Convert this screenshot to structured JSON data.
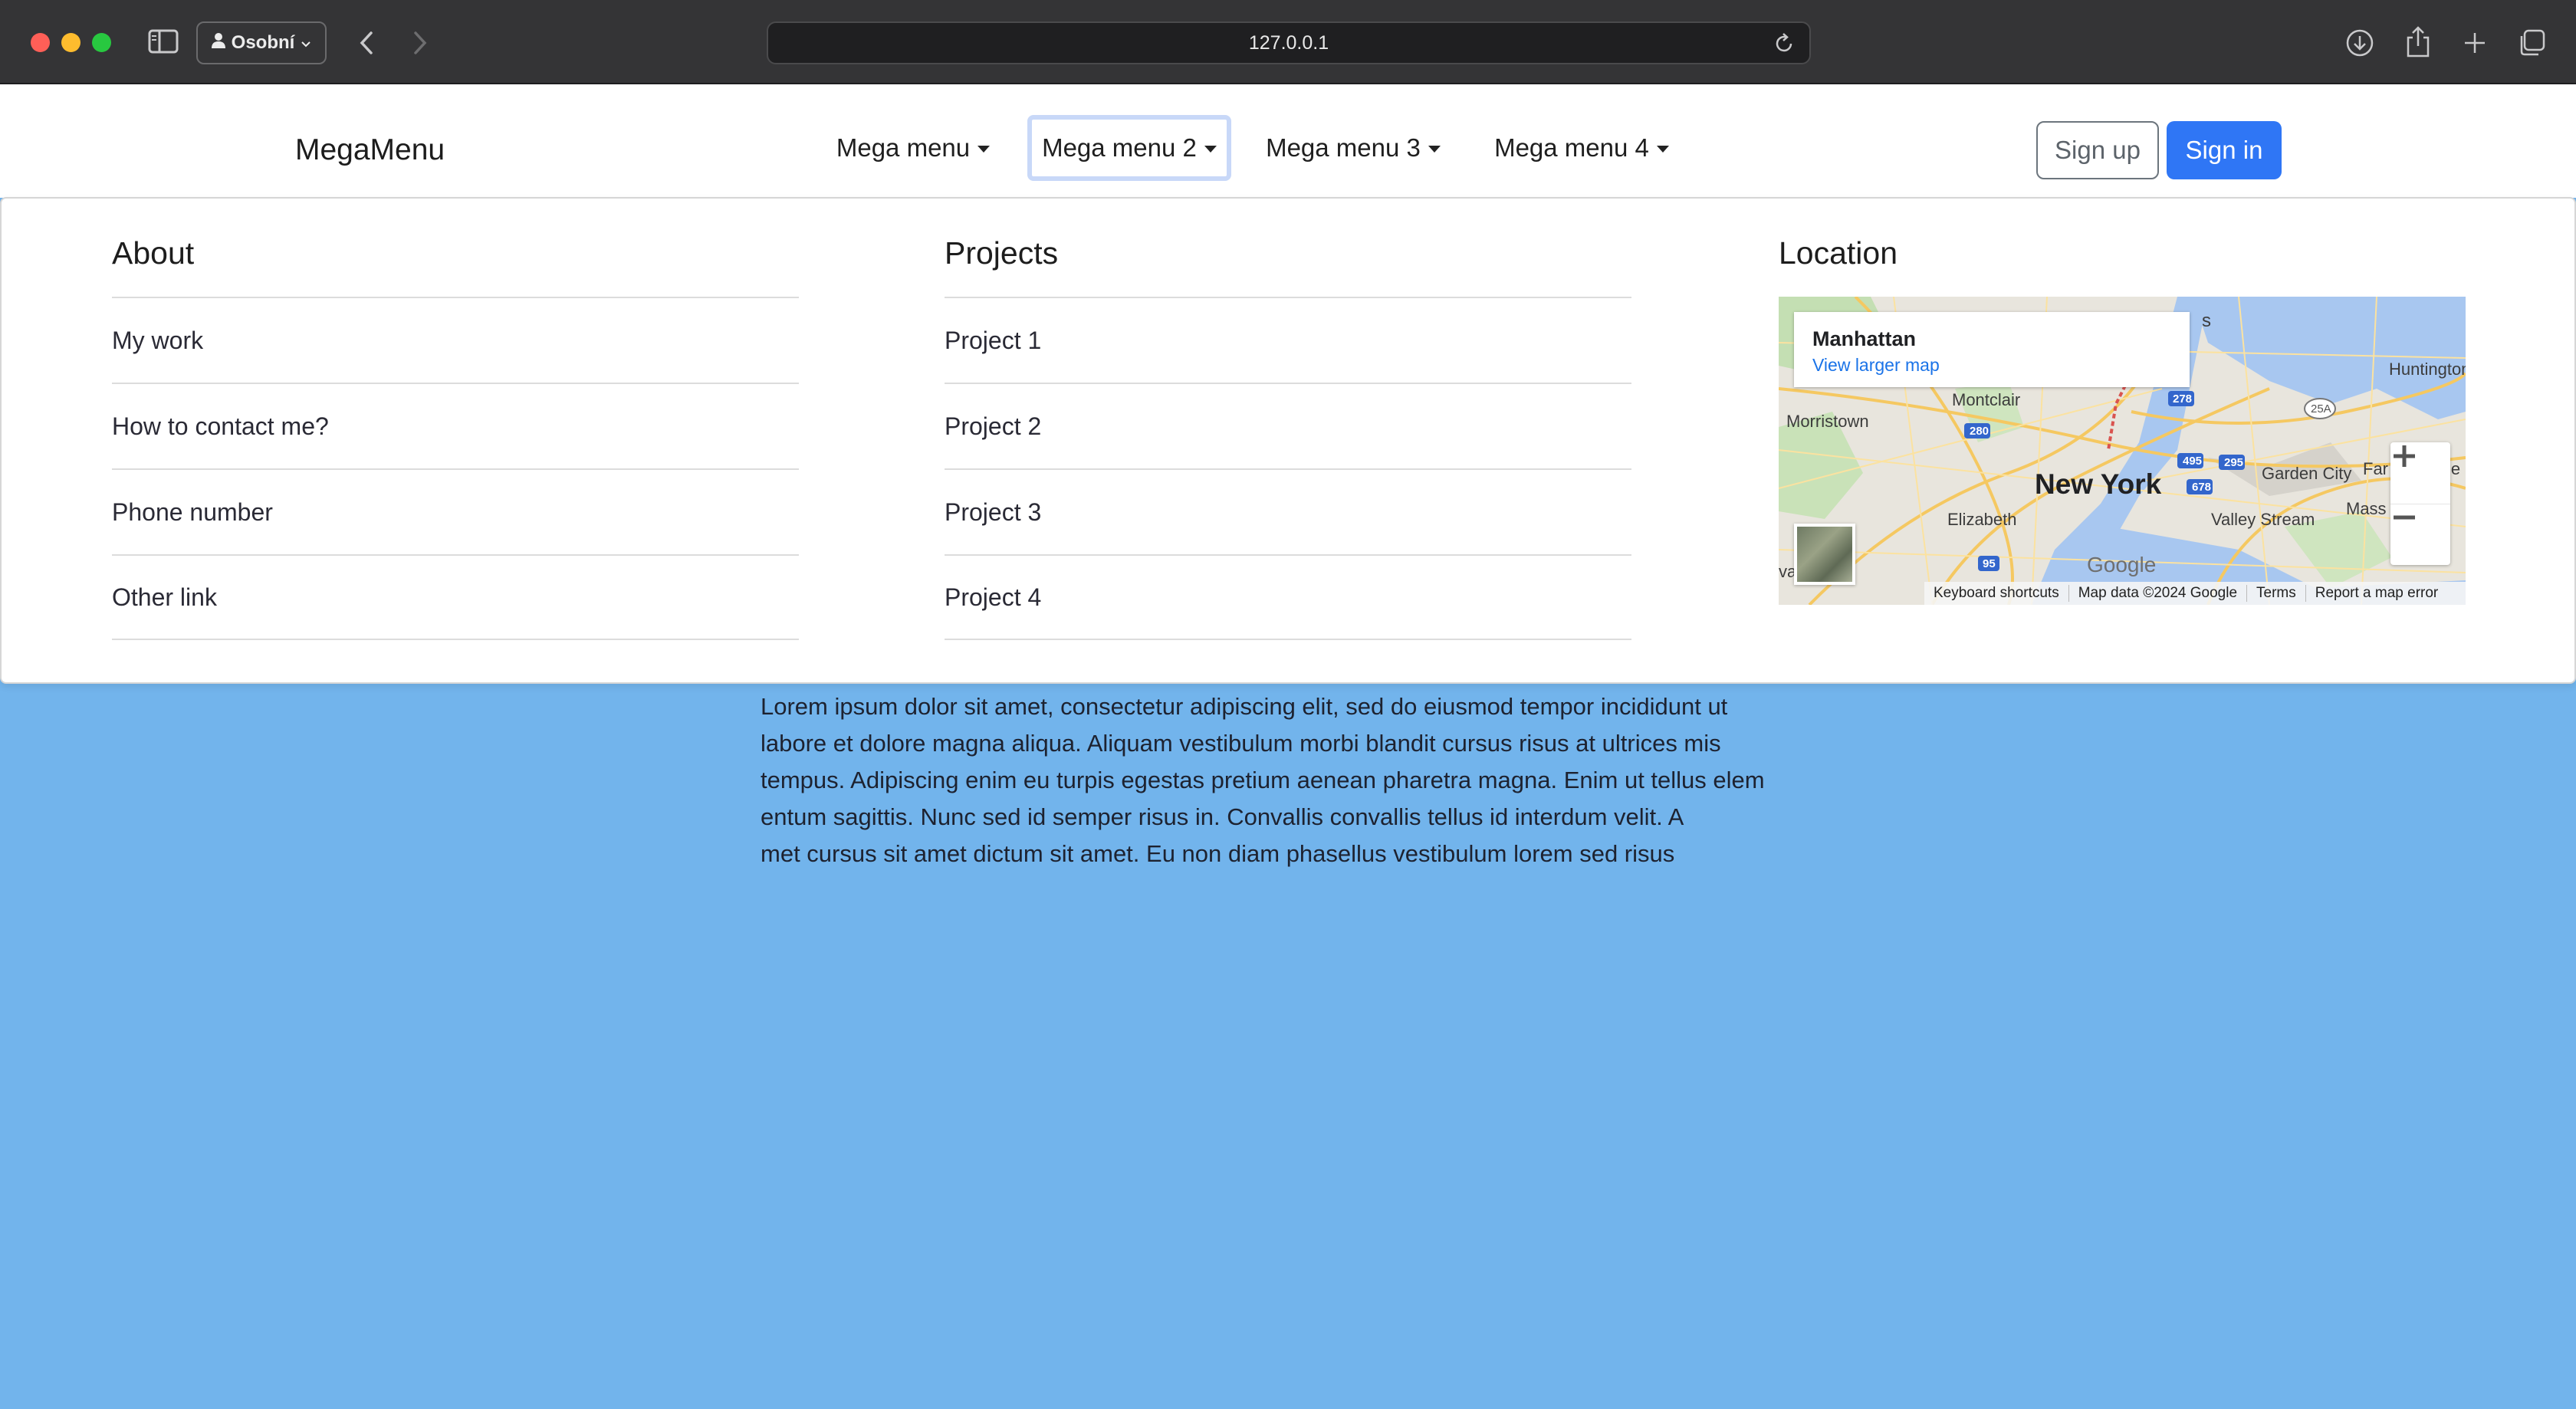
{
  "browser": {
    "profile_label": "Osobní",
    "url": "127.0.0.1"
  },
  "navbar": {
    "brand": "MegaMenu",
    "menus": [
      "Mega menu",
      "Mega menu 2",
      "Mega menu 3",
      "Mega menu 4"
    ],
    "sign_up": "Sign up",
    "sign_in": "Sign in"
  },
  "mega": {
    "about": {
      "title": "About",
      "links": [
        "My work",
        "How to contact me?",
        "Phone number",
        "Other link"
      ]
    },
    "projects": {
      "title": "Projects",
      "links": [
        "Project 1",
        "Project 2",
        "Project 3",
        "Project 4"
      ]
    },
    "location": {
      "title": "Location",
      "place": "Manhattan",
      "larger_map": "View larger map",
      "labels": {
        "montclair": "Montclair",
        "morristown": "Morristown",
        "new_york": "New York",
        "elizabeth": "Elizabeth",
        "garden_city": "Garden City",
        "valley_stream": "Valley Stream",
        "huntington": "Huntington",
        "far": "Far",
        "mass": "Mass",
        "s": "s",
        "le": "le",
        "va": "va"
      },
      "google": "Google",
      "footer": [
        "Keyboard shortcuts",
        "Map data ©2024 Google",
        "Terms",
        "Report a map error"
      ]
    }
  },
  "lorem_lines": [
    "Lorem ipsum dolor sit amet, consectetur adipiscing elit, sed do eiusmod tempor incididunt ut",
    "labore et dolore magna aliqua. Aliquam vestibulum morbi blandit cursus risus at ultrices mis",
    "tempus. Adipiscing enim eu turpis egestas pretium aenean pharetra magna. Enim ut tellus elem",
    "entum sagittis. Nunc sed id semper risus in. Convallis convallis tellus id interdum velit. A",
    "met cursus sit amet dictum sit amet. Eu non diam phasellus vestibulum lorem sed risus"
  ],
  "colors": {
    "page_background": "#72b4ec",
    "primary": "#2f76f5",
    "link_blue": "#1a73e8"
  }
}
